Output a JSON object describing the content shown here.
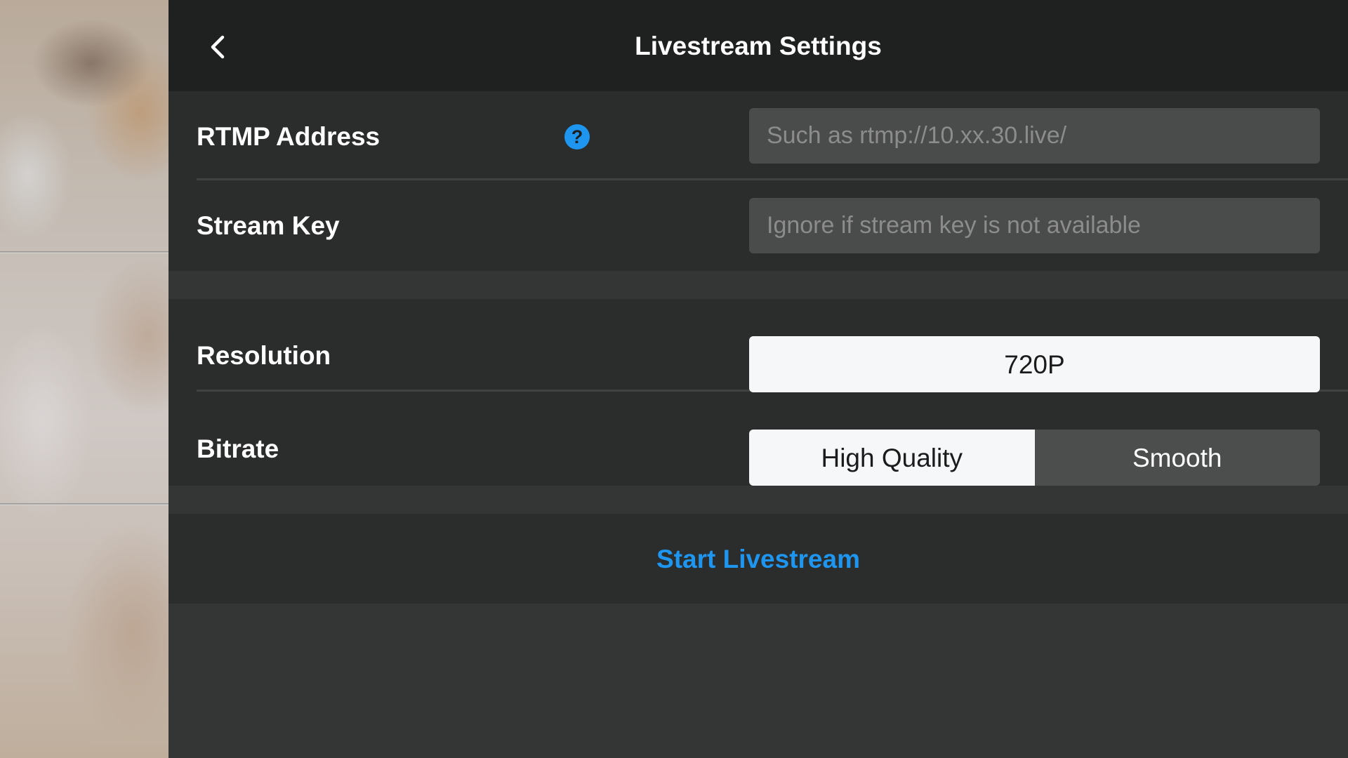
{
  "header": {
    "title": "Livestream Settings",
    "back_icon": "chevron-left-icon"
  },
  "stream": {
    "rtmp_label": "RTMP Address",
    "rtmp_help_glyph": "?",
    "rtmp_placeholder": "Such as rtmp://10.xx.30.live/",
    "rtmp_value": "",
    "key_label": "Stream Key",
    "key_placeholder": "Ignore if stream key is not available",
    "key_value": ""
  },
  "video": {
    "resolution_label": "Resolution",
    "resolution_value": "720P",
    "bitrate_label": "Bitrate",
    "bitrate_options": [
      "High Quality",
      "Smooth"
    ],
    "bitrate_selected": "High Quality"
  },
  "actions": {
    "start_label": "Start Livestream"
  },
  "colors": {
    "accent": "#1e96f0",
    "header_bg": "#1f2020",
    "section_bg": "#2b2c2c",
    "panel_bg": "#343535"
  }
}
